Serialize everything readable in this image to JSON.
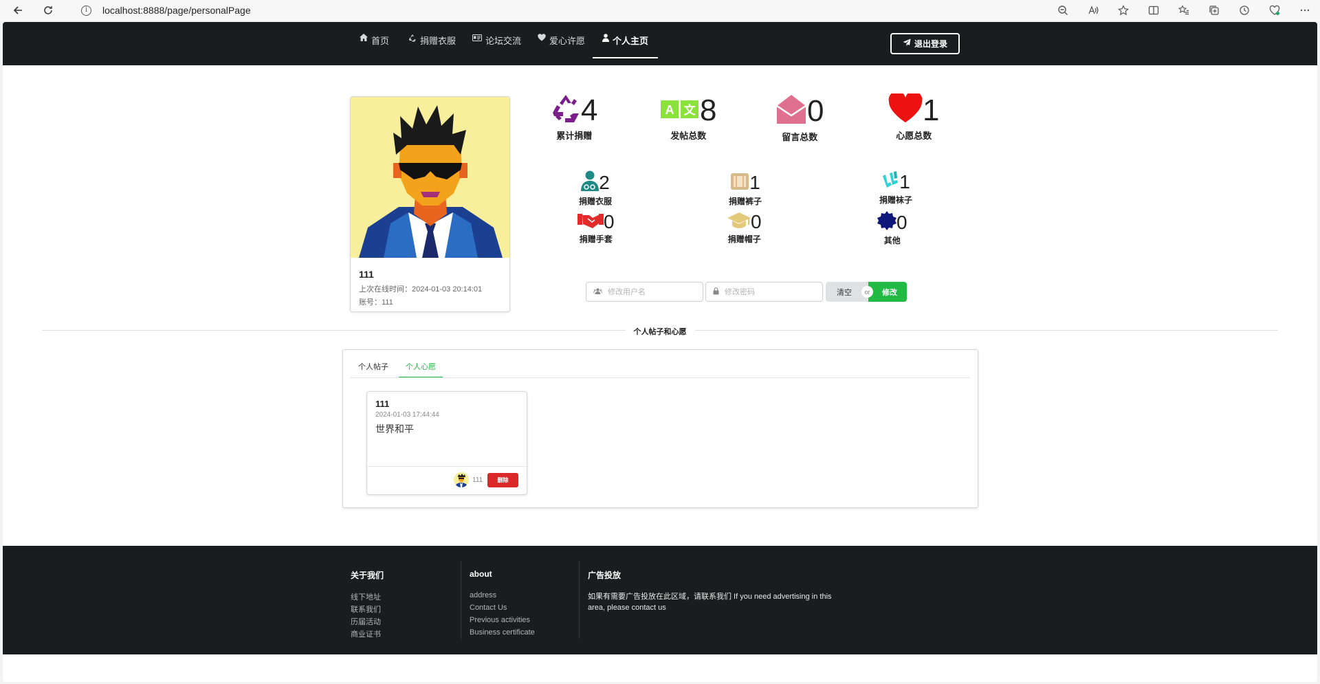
{
  "browser": {
    "url": "localhost:8888/page/personalPage"
  },
  "nav": {
    "items": [
      {
        "label": "首页",
        "icon": "home-icon"
      },
      {
        "label": "捐赠衣服",
        "icon": "recycle-icon"
      },
      {
        "label": "论坛交流",
        "icon": "id-card-icon"
      },
      {
        "label": "爱心许愿",
        "icon": "heart-icon"
      },
      {
        "label": "个人主页",
        "icon": "user-icon"
      }
    ],
    "active": "个人主页",
    "logout_label": "退出登录"
  },
  "profile": {
    "name": "111",
    "last_online": "上次在线时间：2024-01-03 20:14:01",
    "account": "账号：111"
  },
  "stats": [
    {
      "value": "4",
      "label": "累计捐赠",
      "icon": "recycle-icon",
      "color": "#7a1e8c"
    },
    {
      "value": "8",
      "label": "发帖总数",
      "icon": "translate-icon",
      "color": "#8be23b"
    },
    {
      "value": "0",
      "label": "留言总数",
      "icon": "envelope-open-icon",
      "color": "#e0708f"
    },
    {
      "value": "1",
      "label": "心愿总数",
      "icon": "heart-icon",
      "color": "#ee1111"
    }
  ],
  "substats": [
    {
      "value": "2",
      "label": "捐赠衣服",
      "icon": "user-doctor-icon",
      "color": "#1f8a85"
    },
    {
      "value": "1",
      "label": "捐赠裤子",
      "icon": "suitcase-icon",
      "color": "#d9b98a"
    },
    {
      "value": "1",
      "label": "捐赠袜子",
      "icon": "socks-icon",
      "color": "#32d1d6"
    },
    {
      "value": "0",
      "label": "捐赠手套",
      "icon": "handshake-icon",
      "color": "#e32b2b"
    },
    {
      "value": "0",
      "label": "捐赠帽子",
      "icon": "graduation-cap-icon",
      "color": "#e3c97a"
    },
    {
      "value": "0",
      "label": "其他",
      "icon": "certificate-icon",
      "color": "#10177a"
    }
  ],
  "form": {
    "username_placeholder": "修改用户名",
    "password_placeholder": "修改密码",
    "clear_label": "清空",
    "or_label": "or",
    "save_label": "修改"
  },
  "section": {
    "title": "个人帖子和心愿"
  },
  "tabs": {
    "items": [
      "个人帖子",
      "个人心愿"
    ],
    "active": "个人心愿"
  },
  "wish_card": {
    "title": "111",
    "date": "2024-01-03 17:44:44",
    "content": "世界和平",
    "user": "111",
    "delete_label": "删除"
  },
  "footer": {
    "col1": {
      "title": "关于我们",
      "links": [
        "线下地址",
        "联系我们",
        "历届活动",
        "商业证书"
      ]
    },
    "col2": {
      "title": "about",
      "links": [
        "address",
        "Contact Us",
        "Previous activities",
        "Business certificate"
      ]
    },
    "col3": {
      "title": "广告投放",
      "text": "如果有需要广告投放在此区域，请联系我们 If you need advertising in this area, please contact us"
    }
  },
  "colors": {
    "nav_bg": "#1b1c1d",
    "accent_green": "#21ba45",
    "delete_red": "#db2828"
  }
}
